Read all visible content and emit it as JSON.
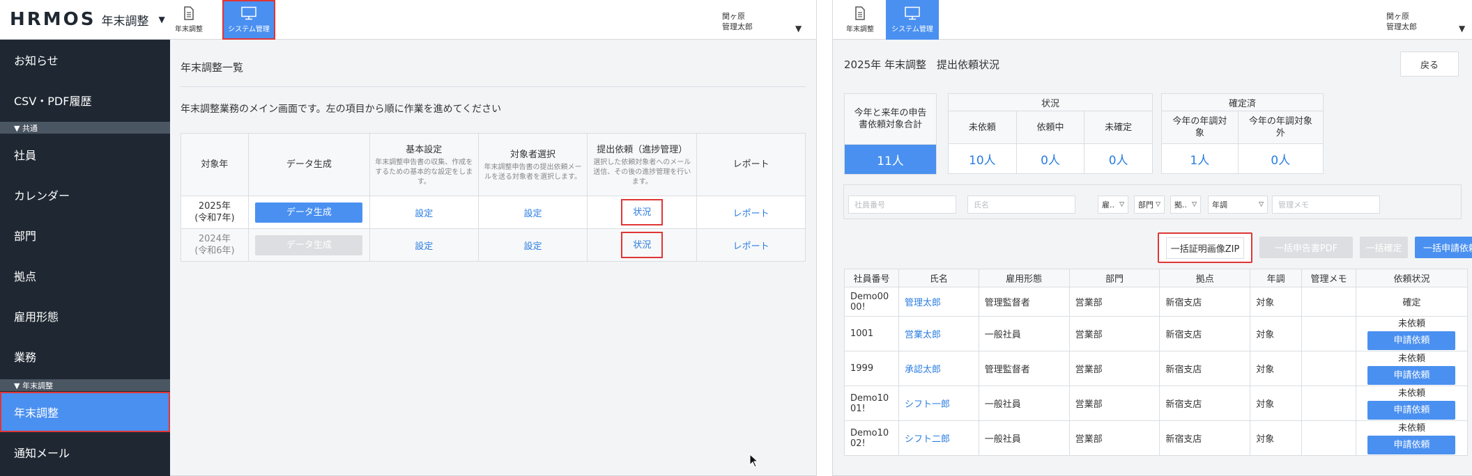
{
  "left": {
    "logo": {
      "mark": "HRMOS",
      "product": "年末調整"
    },
    "sidebar": {
      "items": [
        {
          "label": "お知らせ"
        },
        {
          "label": "CSV・PDF履歴"
        },
        {
          "section": "▼ 共通"
        },
        {
          "label": "社員"
        },
        {
          "label": "カレンダー"
        },
        {
          "label": "部門"
        },
        {
          "label": "拠点"
        },
        {
          "label": "雇用形態"
        },
        {
          "label": "業務"
        },
        {
          "section": "▼ 年末調整"
        },
        {
          "label": "年末調整",
          "active": true
        },
        {
          "label": "通知メール"
        }
      ]
    },
    "tabs": [
      {
        "label": "年末調整",
        "icon": "document-icon"
      },
      {
        "label": "システム管理",
        "icon": "monitor-icon",
        "active": true
      }
    ],
    "user": {
      "org": "関ヶ原",
      "name": "管理太郎"
    },
    "page_title": "年末調整一覧",
    "description": "年末調整業務のメイン画面です。左の項目から順に作業を進めてください",
    "table": {
      "headers": [
        {
          "title": "対象年"
        },
        {
          "title": "データ生成"
        },
        {
          "title": "基本設定",
          "note": "年末調整申告書の収集、作成をするための基本的な設定をします。"
        },
        {
          "title": "対象者選択",
          "note": "年末調整申告書の提出依頼メールを送る対象者を選択します。"
        },
        {
          "title": "提出依頼（進捗管理）",
          "note": "選択した依頼対象者へのメール送信、その後の進捗管理を行います。"
        },
        {
          "title": "レポート"
        }
      ],
      "rows": [
        {
          "year": "2025年",
          "era": "(令和7年)",
          "generate": "データ生成",
          "settings": "設定",
          "select": "設定",
          "status": "状況",
          "report": "レポート"
        },
        {
          "year": "2024年",
          "era": "(令和6年)",
          "generate": "データ生成",
          "settings": "設定",
          "select": "設定",
          "status": "状況",
          "report": "レポート"
        }
      ]
    }
  },
  "right": {
    "tabs": [
      {
        "label": "年末調整",
        "icon": "document-icon"
      },
      {
        "label": "システム管理",
        "icon": "monitor-icon",
        "active": true
      }
    ],
    "user": {
      "org": "関ヶ原",
      "name": "管理太郎"
    },
    "page_title": "2025年 年末調整　提出依頼状況",
    "back_label": "戻る",
    "summary": {
      "total_header": "今年と来年の申告書依頼対象合計",
      "total_value": "11人",
      "status_header": "状況",
      "status_cols": [
        {
          "label": "未依頼",
          "value": "10人"
        },
        {
          "label": "依頼中",
          "value": "0人"
        },
        {
          "label": "未確定",
          "value": "0人"
        }
      ],
      "confirmed_header": "確定済",
      "confirmed_cols": [
        {
          "label": "今年の年調対象",
          "value": "1人"
        },
        {
          "label": "今年の年調対象外",
          "value": "0人"
        }
      ]
    },
    "filters": {
      "employee_no_placeholder": "社員番号",
      "name_placeholder": "氏名",
      "sel_employment": "雇..",
      "sel_dept": "部門",
      "sel_site": "拠..",
      "sel_nencho": "年調",
      "memo_placeholder": "管理メモ"
    },
    "actions": {
      "zip": "一括証明画像ZIP",
      "pdf": "一括申告書PDF",
      "fix": "一括確定",
      "request": "一括申請依頼"
    },
    "table": {
      "headers": [
        "社員番号",
        "氏名",
        "雇用形態",
        "部門",
        "拠点",
        "年調",
        "管理メモ",
        "依頼状況"
      ],
      "rows": [
        {
          "no": "Demo0000!",
          "name": "管理太郎",
          "type": "管理監督者",
          "dept": "営業部",
          "site": "新宿支店",
          "nencho": "対象",
          "memo": "",
          "state": "確定",
          "button": ""
        },
        {
          "no": "1001",
          "name": "営業太郎",
          "type": "一般社員",
          "dept": "営業部",
          "site": "新宿支店",
          "nencho": "対象",
          "memo": "",
          "state": "未依頼",
          "button": "申請依頼"
        },
        {
          "no": "1999",
          "name": "承認太郎",
          "type": "管理監督者",
          "dept": "営業部",
          "site": "新宿支店",
          "nencho": "対象",
          "memo": "",
          "state": "未依頼",
          "button": "申請依頼"
        },
        {
          "no": "Demo1001!",
          "name": "シフト一郎",
          "type": "一般社員",
          "dept": "営業部",
          "site": "新宿支店",
          "nencho": "対象",
          "memo": "",
          "state": "未依頼",
          "button": "申請依頼"
        },
        {
          "no": "Demo1002!",
          "name": "シフト二郎",
          "type": "一般社員",
          "dept": "営業部",
          "site": "新宿支店",
          "nencho": "対象",
          "memo": "",
          "state": "未依頼",
          "button": "申請依頼"
        }
      ]
    }
  },
  "colors": {
    "accent": "#4a90f0",
    "highlight": "#e03535",
    "sidebar": "#1f2832",
    "link": "#2a7de1"
  }
}
